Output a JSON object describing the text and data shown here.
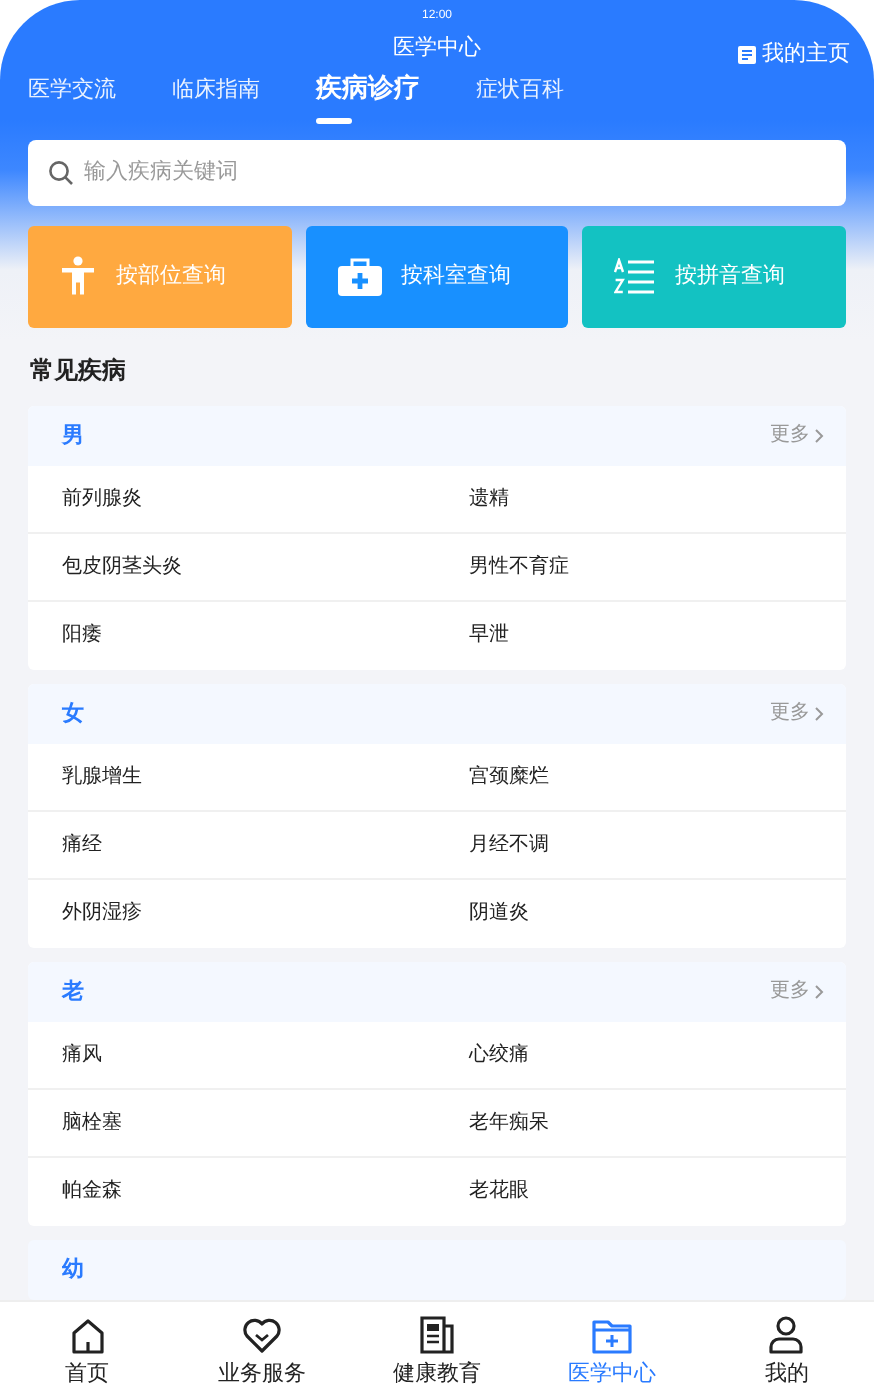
{
  "status_bar": {
    "time": "12:00"
  },
  "header": {
    "title": "医学中心",
    "home_link": "我的主页"
  },
  "tabs": [
    {
      "label": "医学交流",
      "selected": false
    },
    {
      "label": "临床指南",
      "selected": false
    },
    {
      "label": "疾病诊疗",
      "selected": true
    },
    {
      "label": "症状百科",
      "selected": false
    }
  ],
  "search": {
    "placeholder": "输入疾病关键词"
  },
  "query_buttons": [
    {
      "kind": "body",
      "label": "按部位查询",
      "color": "#ffa940"
    },
    {
      "kind": "department",
      "label": "按科室查询",
      "color": "#1890ff"
    },
    {
      "kind": "pinyin",
      "label": "按拼音查询",
      "color": "#13c2c2"
    }
  ],
  "section_title": "常见疾病",
  "groups": [
    {
      "title": "男",
      "more": "更多",
      "diseases": [
        "前列腺炎",
        "遗精",
        "包皮阴茎头炎",
        "男性不育症",
        "阳痿",
        "早泄"
      ]
    },
    {
      "title": "女",
      "more": "更多",
      "diseases": [
        "乳腺增生",
        "宫颈糜烂",
        "痛经",
        "月经不调",
        "外阴湿疹",
        "阴道炎"
      ]
    },
    {
      "title": "老",
      "more": "更多",
      "diseases": [
        "痛风",
        "心绞痛",
        "脑栓塞",
        "老年痴呆",
        "帕金森",
        "老花眼"
      ]
    },
    {
      "title": "幼"
    }
  ],
  "bottom_nav": [
    {
      "kind": "home",
      "label": "首页",
      "selected": false
    },
    {
      "kind": "heart",
      "label": "业务服务",
      "selected": false
    },
    {
      "kind": "news",
      "label": "健康教育",
      "selected": false
    },
    {
      "kind": "medical",
      "label": "医学中心",
      "selected": true
    },
    {
      "kind": "person",
      "label": "我的",
      "selected": false
    }
  ]
}
